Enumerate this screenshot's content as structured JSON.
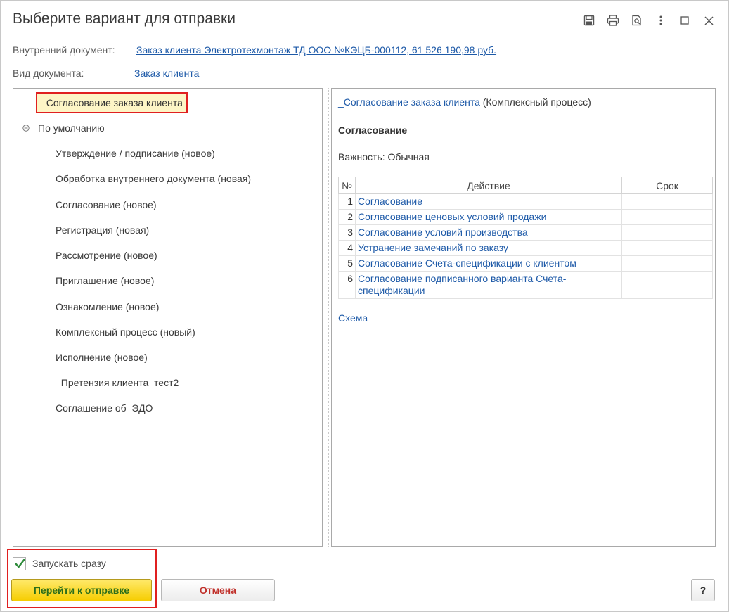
{
  "window": {
    "title": "Выберите вариант для отправки",
    "tools": [
      "save-icon",
      "print-icon",
      "preview-icon",
      "more-icon",
      "maximize-icon",
      "close-icon"
    ]
  },
  "header": {
    "internal_doc_label": "Внутренний документ:",
    "internal_doc_value": "Заказ клиента Электротехмонтаж ТД ООО №КЭЦБ-000112, 61 526 190,98 руб.",
    "doc_type_label": "Вид документа:",
    "doc_type_value": "Заказ клиента"
  },
  "tree": {
    "selected": "_Согласование заказа клиента",
    "group": "По умолчанию",
    "items": [
      "Утверждение / подписание (новое)",
      "Обработка внутреннего документа (новая)",
      "Согласование (новое)",
      "Регистрация (новая)",
      "Рассмотрение (новое)",
      "Приглашение (новое)",
      "Ознакомление (новое)",
      "Комплексный процесс (новый)",
      "Исполнение (новое)",
      "_Претензия клиента_тест2",
      "Соглашение об  ЭДО"
    ]
  },
  "details": {
    "process_link": "_Согласование заказа клиента",
    "process_type": "(Комплексный процесс)",
    "section_title": "Согласование",
    "importance": "Важность: Обычная",
    "columns": {
      "num": "№",
      "action": "Действие",
      "term": "Срок"
    },
    "rows": [
      {
        "num": "1",
        "action": "Согласование",
        "term": ""
      },
      {
        "num": "2",
        "action": "Согласование ценовых условий продажи",
        "term": ""
      },
      {
        "num": "3",
        "action": "Согласование условий производства",
        "term": ""
      },
      {
        "num": "4",
        "action": "Устранение замечаний по заказу",
        "term": ""
      },
      {
        "num": "5",
        "action": "Согласование Счета-спецификации с клиентом",
        "term": ""
      },
      {
        "num": "6",
        "action": "Согласование подписанного варианта Счета-спецификации",
        "term": ""
      }
    ],
    "schema_link": "Схема"
  },
  "footer": {
    "start_now_label": "Запускать сразу",
    "start_now_checked": true,
    "primary_button": "Перейти к отправке",
    "cancel_button": "Отмена",
    "help_button": "?"
  },
  "colors": {
    "link": "#1e5aa8",
    "highlight_border": "#e02020",
    "primary_button": "#f6cd00",
    "cancel_text": "#c0302a",
    "checkmark": "#2e8b3a"
  }
}
